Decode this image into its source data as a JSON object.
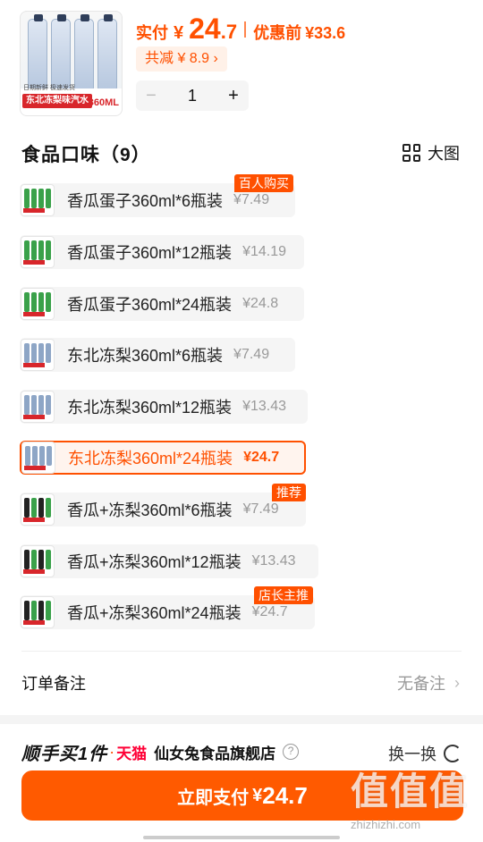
{
  "header": {
    "thumb": {
      "brand_text": "东北冻梨味汽水",
      "volume": "360ML",
      "tiny": "日期新鲜 极速发货"
    },
    "price_label": "实付",
    "currency": "¥",
    "price_int": "24",
    "price_dec": ".7",
    "original_label": "优惠前",
    "original_price": "¥33.6",
    "reduce_text": "共减 ¥ 8.9 ›",
    "stepper": {
      "minus": "−",
      "qty": "1",
      "plus": "+"
    }
  },
  "section": {
    "title": "食品口味（9）",
    "big_view": "大图"
  },
  "options": [
    {
      "name": "香瓜蛋子360ml*6瓶装",
      "price": "¥7.49",
      "badge": "百人购买",
      "kind": "green",
      "selected": false
    },
    {
      "name": "香瓜蛋子360ml*12瓶装",
      "price": "¥14.19",
      "badge": "",
      "kind": "green",
      "selected": false
    },
    {
      "name": "香瓜蛋子360ml*24瓶装",
      "price": "¥24.8",
      "badge": "",
      "kind": "green",
      "selected": false
    },
    {
      "name": "东北冻梨360ml*6瓶装",
      "price": "¥7.49",
      "badge": "",
      "kind": "blue",
      "selected": false
    },
    {
      "name": "东北冻梨360ml*12瓶装",
      "price": "¥13.43",
      "badge": "",
      "kind": "blue",
      "selected": false
    },
    {
      "name": "东北冻梨360ml*24瓶装",
      "price": "¥24.7",
      "badge": "",
      "kind": "blue",
      "selected": true
    },
    {
      "name": "香瓜+冻梨360ml*6瓶装",
      "price": "¥7.49",
      "badge": "推荐",
      "kind": "mix",
      "selected": false
    },
    {
      "name": "香瓜+冻梨360ml*12瓶装",
      "price": "¥13.43",
      "badge": "",
      "kind": "mix",
      "selected": false
    },
    {
      "name": "香瓜+冻梨360ml*24瓶装",
      "price": "¥24.7",
      "badge": "店长主推",
      "kind": "mix",
      "selected": false
    }
  ],
  "remark": {
    "label": "订单备注",
    "value": "无备注"
  },
  "shop": {
    "shunshou": "顺手买1件",
    "dot": "·",
    "tmall": "天猫",
    "name": "仙女兔食品旗舰店",
    "help": "?",
    "swap": "换一换"
  },
  "pay": {
    "label": "立即支付",
    "currency": "¥",
    "amount": "24.7"
  },
  "watermark": {
    "text": "值值值",
    "url": "zhizhizhi.com"
  },
  "colors": {
    "accent": "#ff5000",
    "button": "#ff5a00"
  }
}
